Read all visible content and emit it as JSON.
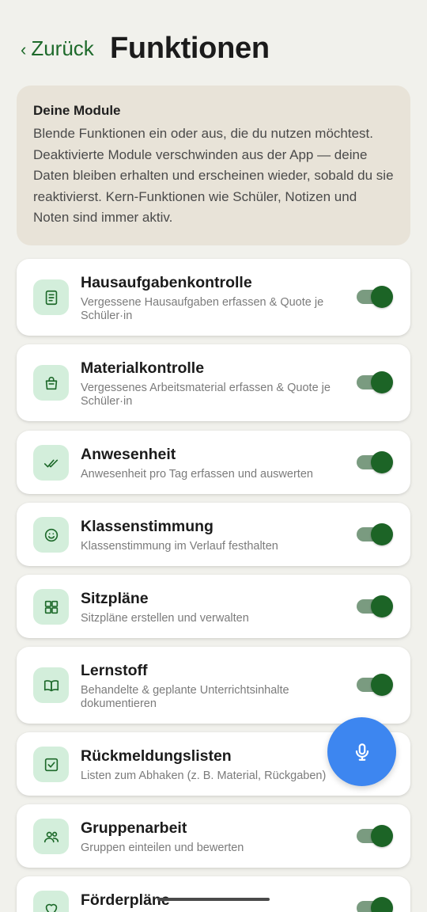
{
  "header": {
    "back_label": "Zurück",
    "title": "Funktionen"
  },
  "info": {
    "title": "Deine Module",
    "text": "Blende Funktionen ein oder aus, die du nutzen möchtest. Deaktivierte Module verschwinden aus der App — deine Daten bleiben erhalten und erscheinen wieder, sobald du sie reaktivierst. Kern-Funktionen wie Schüler, Notizen und Noten sind immer aktiv."
  },
  "modules": [
    {
      "name": "Hausaufgabenkontrolle",
      "desc": "Vergessene Hausaufgaben erfassen & Quote je Schüler·in",
      "icon": "homework-icon",
      "enabled": true
    },
    {
      "name": "Materialkontrolle",
      "desc": "Vergessenes Arbeitsmaterial erfassen & Quote je Schüler·in",
      "icon": "bag-icon",
      "enabled": true
    },
    {
      "name": "Anwesenheit",
      "desc": "Anwesenheit pro Tag erfassen und auswerten",
      "icon": "double-check-icon",
      "enabled": true
    },
    {
      "name": "Klassenstimmung",
      "desc": "Klassenstimmung im Verlauf festhalten",
      "icon": "smiley-icon",
      "enabled": true
    },
    {
      "name": "Sitzpläne",
      "desc": "Sitzpläne erstellen und verwalten",
      "icon": "grid-icon",
      "enabled": true
    },
    {
      "name": "Lernstoff",
      "desc": "Behandelte & geplante Unterrichtsinhalte dokumentieren",
      "icon": "book-icon",
      "enabled": true
    },
    {
      "name": "Rückmeldungslisten",
      "desc": "Listen zum Abhaken (z. B. Material, Rückgaben)",
      "icon": "checkbox-icon",
      "enabled": true
    },
    {
      "name": "Gruppenarbeit",
      "desc": "Gruppen einteilen und bewerten",
      "icon": "people-icon",
      "enabled": true
    },
    {
      "name": "Förderpläne",
      "desc": "",
      "icon": "heart-icon",
      "enabled": true
    }
  ],
  "fab": {
    "icon": "microphone-icon"
  },
  "colors": {
    "accent": "#1e6a2b",
    "toggle_thumb": "#1c6426",
    "toggle_track": "#7a9b80",
    "icon_bg": "#d3eedb",
    "fab": "#3d86f0",
    "info_bg": "#e8e3d8",
    "background": "#f1f1ec"
  }
}
